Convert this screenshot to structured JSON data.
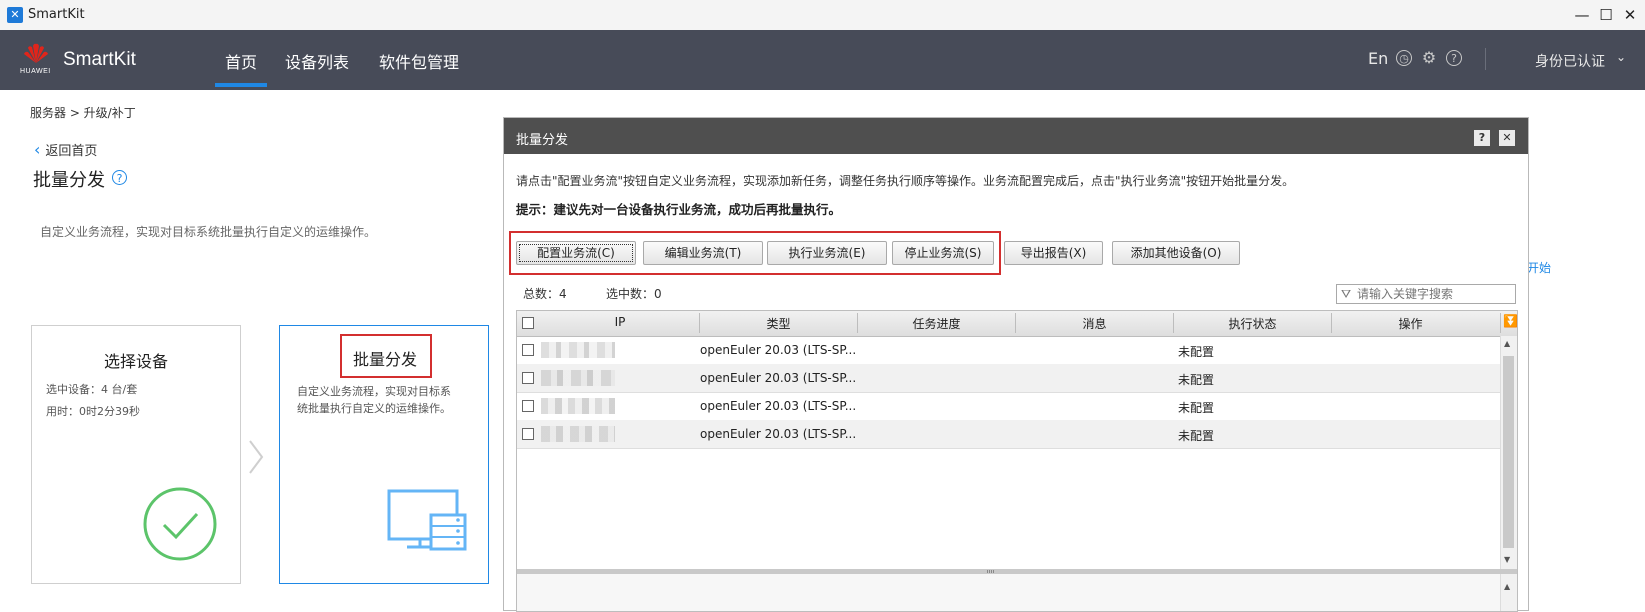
{
  "window": {
    "app_title": "SmartKit",
    "app_icon": "toolbox-icon",
    "controls": [
      "minimize-icon",
      "maximize-icon",
      "close-icon"
    ]
  },
  "nav": {
    "brand_sub": "HUAWEI",
    "brand_title": "SmartKit",
    "tabs": [
      {
        "label": "首页",
        "active": true
      },
      {
        "label": "设备列表"
      },
      {
        "label": "软件包管理"
      }
    ],
    "lang": "En",
    "icons": [
      "clock-icon",
      "gear-icon",
      "help-icon"
    ],
    "user": "身份已认证",
    "accent": "#1f88e5",
    "bg": "#474b58"
  },
  "page": {
    "breadcrumb": "服务器 > 升级/补丁",
    "back": "返回首页",
    "title": "批量分发",
    "description": "自定义业务流程，实现对目标系统批量执行自定义的运维操作。",
    "right_edge_link": "开始",
    "cards": {
      "select": {
        "title": "选择设备",
        "line1": "选中设备：4 台/套",
        "line2": "用时：0时2分39秒",
        "icon": "check-circle-icon"
      },
      "dispatch": {
        "title": "批量分发",
        "line1": "自定义业务流程，实现对目标系",
        "line2": "统批量执行自定义的运维操作。",
        "icon": "server-monitor-icon"
      }
    }
  },
  "dialog": {
    "title": "批量分发",
    "info": "请点击\"配置业务流\"按钮自定义业务流程，实现添加新任务，调整任务执行顺序等操作。业务流配置完成后，点击\"执行业务流\"按钮开始批量分发。",
    "tip": "提示：建议先对一台设备执行业务流，成功后再批量执行。",
    "buttons": {
      "configure": "配置业务流(C)",
      "edit": "编辑业务流(T)",
      "execute": "执行业务流(E)",
      "stop": "停止业务流(S)",
      "export": "导出报告(X)",
      "add_device": "添加其他设备(O)"
    },
    "total": "总数：4",
    "selected": "选中数：0",
    "search_placeholder": "请输入关键字搜索",
    "columns": [
      "IP",
      "类型",
      "任务进度",
      "消息",
      "执行状态",
      "操作"
    ],
    "rows": [
      {
        "ip": "",
        "type": "openEuler 20.03 (LTS-SP...",
        "progress": "",
        "message": "",
        "status": "未配置",
        "action": ""
      },
      {
        "ip": "",
        "type": "openEuler 20.03 (LTS-SP...",
        "progress": "",
        "message": "",
        "status": "未配置",
        "action": ""
      },
      {
        "ip": "",
        "type": "openEuler 20.03 (LTS-SP...",
        "progress": "",
        "message": "",
        "status": "未配置",
        "action": ""
      },
      {
        "ip": "",
        "type": "openEuler 20.03 (LTS-SP...",
        "progress": "",
        "message": "",
        "status": "未配置",
        "action": ""
      }
    ],
    "highlight_color": "#d32f2f"
  }
}
